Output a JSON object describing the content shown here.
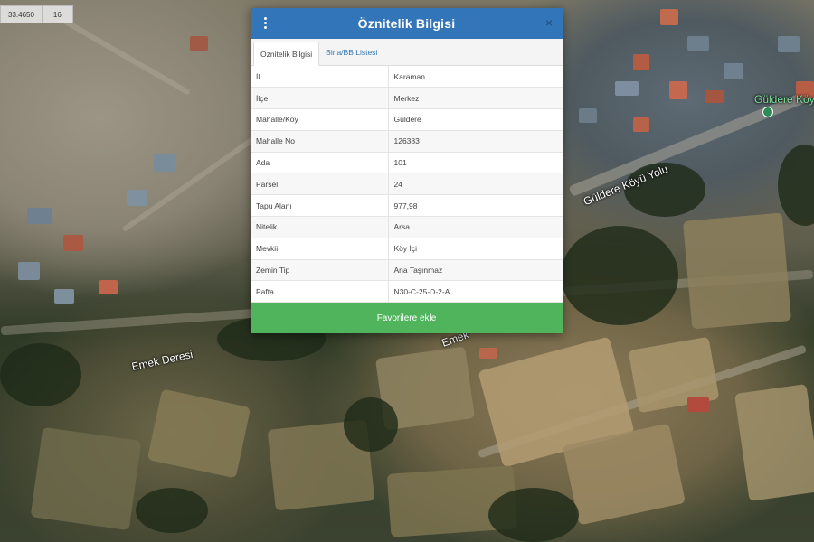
{
  "coords_bar": {
    "value": "33.4650",
    "zoom": "16"
  },
  "map": {
    "labels": {
      "emek_deresi": "Emek Deresi",
      "emek_deresi_2": "Emek",
      "guldere_koyu_yolu": "Güldere Köyü Yolu",
      "guldere_koyu_poi": "Güldere Köyü M"
    },
    "poi_icon": "map-pin-icon"
  },
  "panel": {
    "title": "Öznitelik Bilgisi",
    "menu_icon": "vertical-dots-icon",
    "close_icon": "close-icon",
    "close_glyph": "×",
    "tabs": [
      {
        "label": "Öznitelik Bilgisi",
        "active": true
      },
      {
        "label": "Bina/BB Listesi",
        "active": false
      }
    ],
    "rows": [
      {
        "key": "İl",
        "value": "Karaman"
      },
      {
        "key": "İlçe",
        "value": "Merkez"
      },
      {
        "key": "Mahalle/Köy",
        "value": "Güldere"
      },
      {
        "key": "Mahalle No",
        "value": "126383"
      },
      {
        "key": "Ada",
        "value": "101"
      },
      {
        "key": "Parsel",
        "value": "24"
      },
      {
        "key": "Tapu Alanı",
        "value": "977,98"
      },
      {
        "key": "Nitelik",
        "value": "Arsa"
      },
      {
        "key": "Mevkii",
        "value": "Köy İçi"
      },
      {
        "key": "Zemin Tip",
        "value": "Ana Taşınmaz"
      },
      {
        "key": "Pafta",
        "value": "N30-C-25-D-2-A"
      }
    ],
    "favorites_button": "Favorilere ekle"
  },
  "colors": {
    "header": "#3275b8",
    "favorites": "#4fb45c",
    "tab_link": "#3275b8"
  }
}
